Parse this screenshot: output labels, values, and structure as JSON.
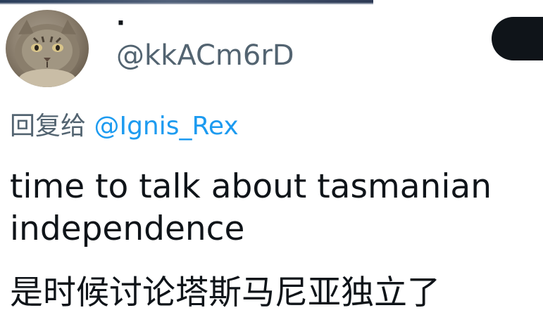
{
  "tweet": {
    "display_name": "·",
    "handle": "@kkACm6rD",
    "follow_button_label": "",
    "reply_prefix": "回复给 ",
    "reply_to": "@Ignis_Rex",
    "text_line_1": "time to talk about tasmanian",
    "text_line_2": "independence",
    "translation": "是时候讨论塔斯马尼亚独立了"
  },
  "icons": {
    "avatar": "cat-avatar-icon"
  },
  "colors": {
    "text_primary": "#0f1419",
    "text_secondary": "#536471",
    "link": "#1d9bf0",
    "follow_button": "#0f1419"
  }
}
